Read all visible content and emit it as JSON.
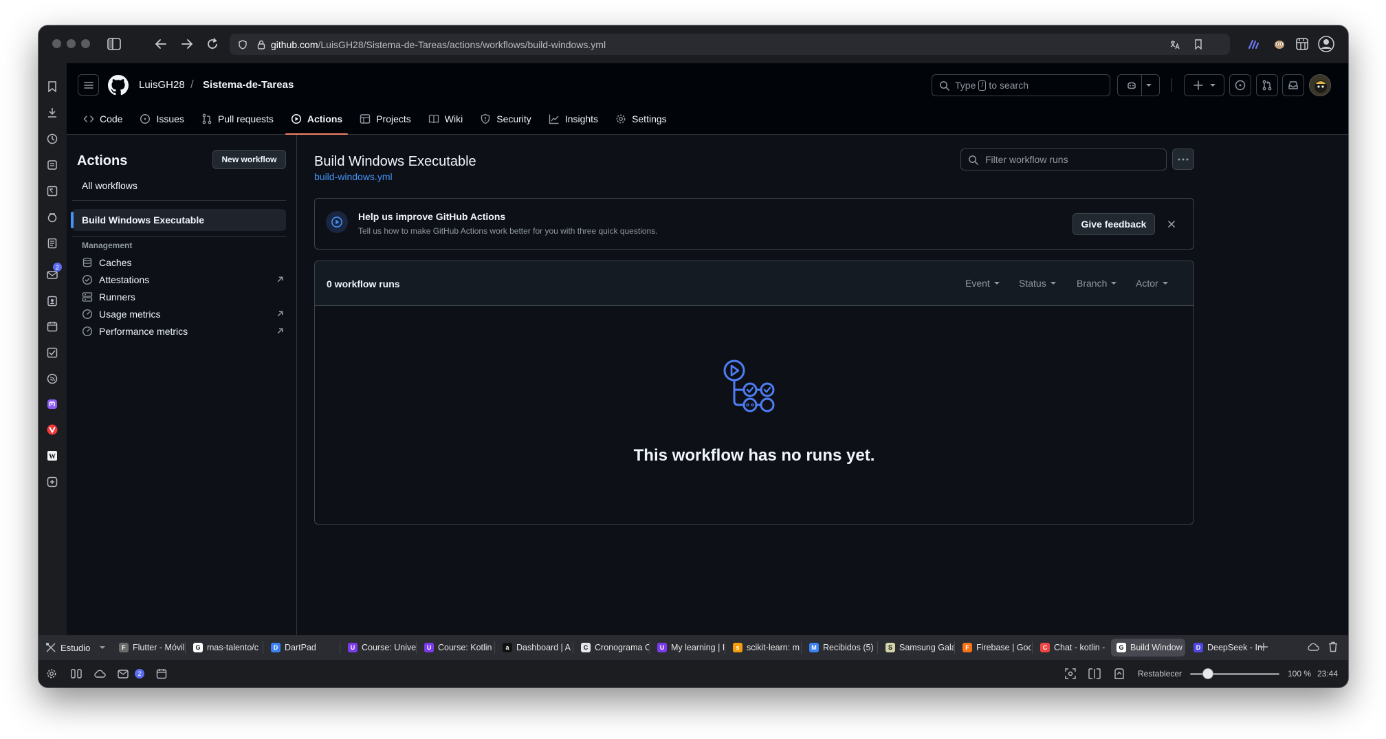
{
  "browser": {
    "url_host": "github.com",
    "url_path": "/LuisGH28/Sistema-de-Tareas/actions/workflows/build-windows.yml"
  },
  "sidepanel": {
    "mail_badge": "2"
  },
  "header": {
    "owner": "LuisGH28",
    "separator": "/",
    "repo": "Sistema-de-Tareas",
    "search_prefix": "Type",
    "search_key": "/",
    "search_suffix": "to search"
  },
  "nav": {
    "tabs": [
      "Code",
      "Issues",
      "Pull requests",
      "Actions",
      "Projects",
      "Wiki",
      "Security",
      "Insights",
      "Settings"
    ],
    "active": "Actions"
  },
  "sidebar": {
    "title": "Actions",
    "new_workflow": "New workflow",
    "all_workflows": "All workflows",
    "selected_workflow": "Build Windows Executable",
    "management_label": "Management",
    "management_items": [
      "Caches",
      "Attestations",
      "Runners",
      "Usage metrics",
      "Performance metrics"
    ]
  },
  "main": {
    "title": "Build Windows Executable",
    "file": "build-windows.yml",
    "filter_placeholder": "Filter workflow runs",
    "feedback_title": "Help us improve GitHub Actions",
    "feedback_subtitle": "Tell us how to make GitHub Actions work better for you with three quick questions.",
    "feedback_button": "Give feedback",
    "runs_count": "0 workflow runs",
    "filters": [
      "Event",
      "Status",
      "Branch",
      "Actor"
    ],
    "empty_message": "This workflow has no runs yet."
  },
  "tabs_bar": {
    "workspace": "Estudio",
    "tabs": [
      {
        "label": "Flutter - Móvil",
        "color": "#6b6b6b",
        "glyph": "F"
      },
      {
        "label": "mas-talento/c",
        "color": "#ffffff",
        "glyph": "G"
      },
      {
        "label": "DartPad",
        "color": "#3b82f6",
        "glyph": "D"
      },
      {
        "label": "Course: Unive",
        "color": "#7c3aed",
        "glyph": "U"
      },
      {
        "label": "Course: Kotlin",
        "color": "#7c3aed",
        "glyph": "U"
      },
      {
        "label": "Dashboard | A",
        "color": "#111111",
        "glyph": "a"
      },
      {
        "label": "Cronograma C",
        "color": "#e5e7eb",
        "glyph": "C"
      },
      {
        "label": "My learning | I",
        "color": "#7c3aed",
        "glyph": "U"
      },
      {
        "label": "scikit-learn: m",
        "color": "#f59e0b",
        "glyph": "s"
      },
      {
        "label": "Recibidos (5)",
        "color": "#3b82f6",
        "glyph": "M"
      },
      {
        "label": "Samsung Gala",
        "color": "#d4d4aa",
        "glyph": "S"
      },
      {
        "label": "Firebase | Goo",
        "color": "#f97316",
        "glyph": "F"
      },
      {
        "label": "Chat - kotlin -",
        "color": "#ef4444",
        "glyph": "C"
      },
      {
        "label": "Build Window",
        "color": "#ffffff",
        "glyph": "G"
      },
      {
        "label": "DeepSeek - In",
        "color": "#4f46e5",
        "glyph": "D"
      }
    ],
    "active_index": 13
  },
  "statusbar": {
    "mail_badge": "2",
    "reset_label": "Restablecer",
    "zoom": "100 %",
    "zoom_fraction": 0.2,
    "clock": "23:44"
  }
}
